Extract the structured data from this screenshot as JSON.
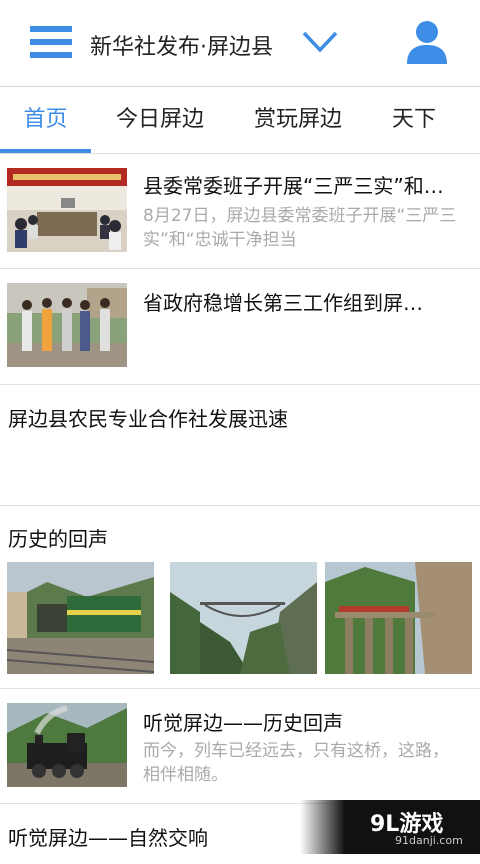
{
  "header": {
    "title": "新华社发布·屏边县",
    "menu_icon": "hamburger-menu-icon",
    "dropdown_icon": "chevron-down-icon",
    "user_icon": "user-profile-icon",
    "accent_color": "#3d8ce6"
  },
  "tabs": [
    {
      "label": "首页",
      "active": true
    },
    {
      "label": "今日屏边",
      "active": false
    },
    {
      "label": "赏玩屏边",
      "active": false
    },
    {
      "label": "天下",
      "active": false
    }
  ],
  "news": [
    {
      "title": "县委常委班子开展“三严三实”和…",
      "desc": "8月27日，屏边县委常委班子开展“三严三实”和“忠诚干净担当"
    },
    {
      "title": "省政府稳增长第三工作组到屏…"
    },
    {
      "title": "屏边县农民专业合作社发展迅速"
    }
  ],
  "gallery": {
    "title": "历史的回声"
  },
  "audio_items": [
    {
      "title": "听觉屏边——历史回声",
      "desc": "而今，列车已经远去，只有这桥，这路，相伴相随。"
    },
    {
      "title": "听觉屏边——自然交响"
    }
  ],
  "watermark": {
    "logo": "9L游戏",
    "site": "91danji.com"
  }
}
